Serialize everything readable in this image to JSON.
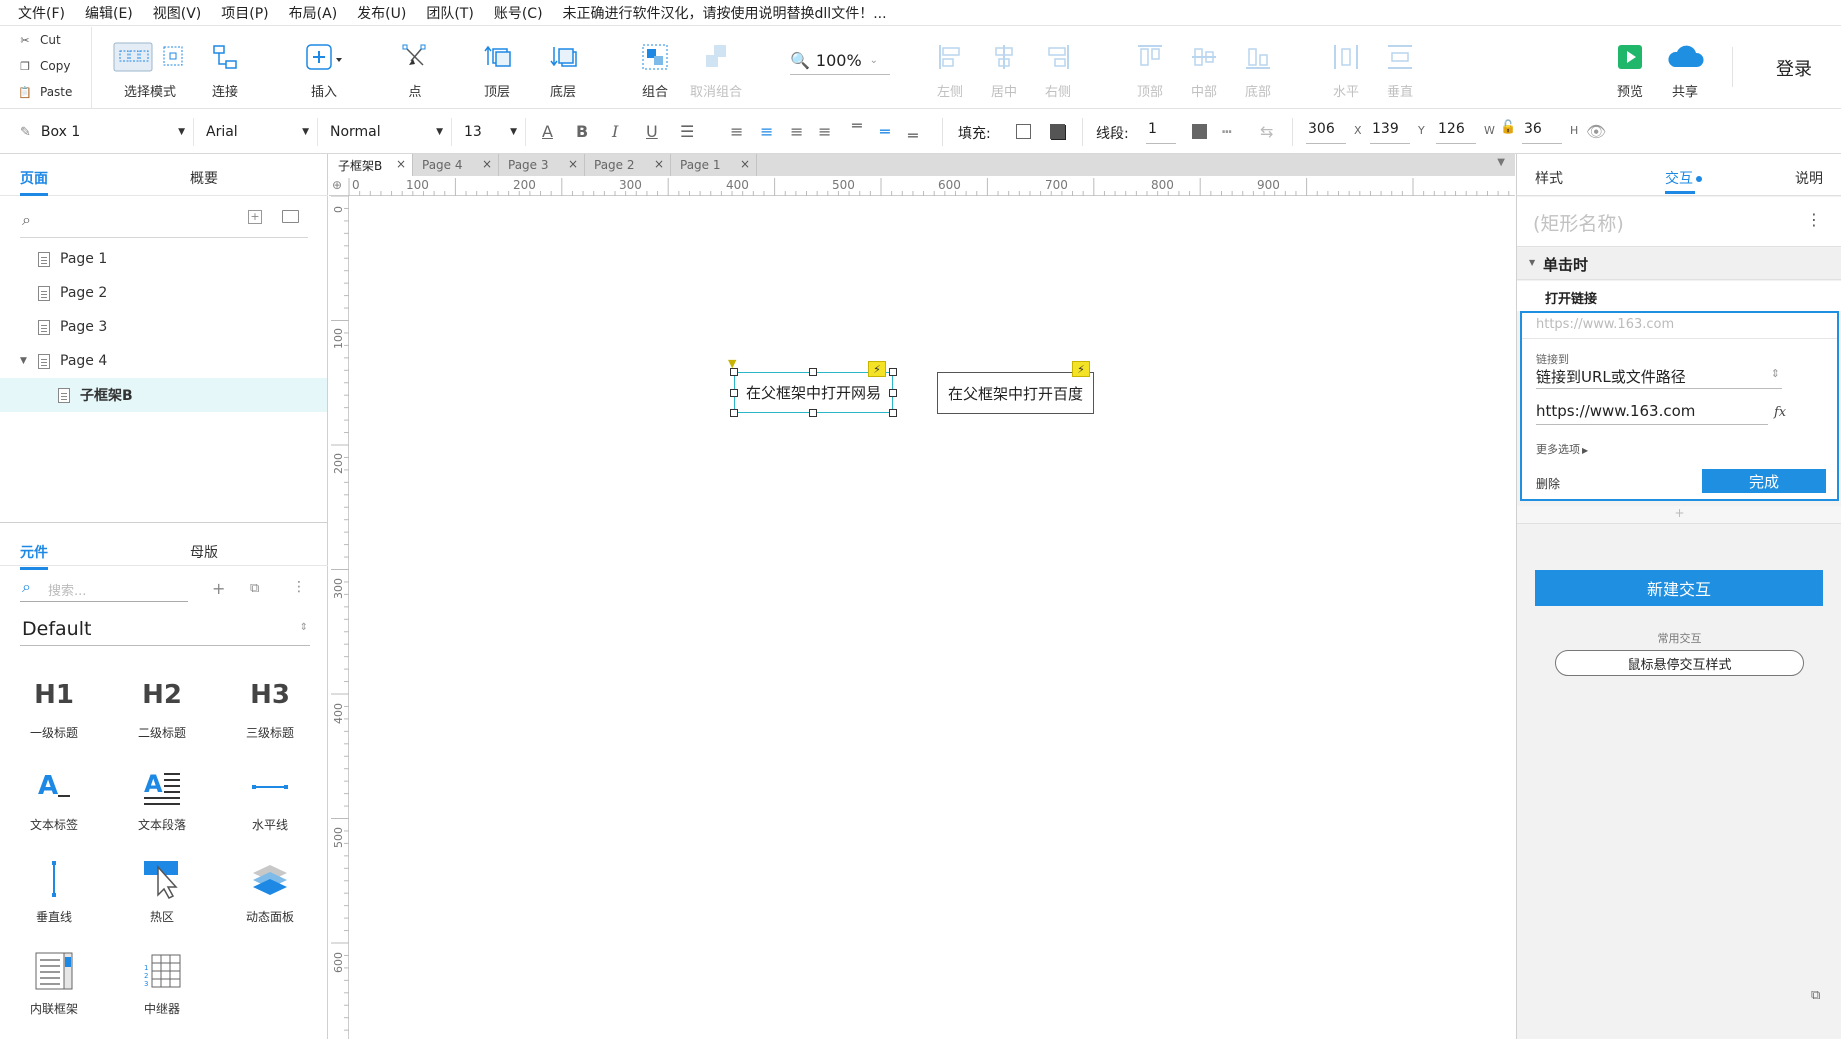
{
  "menu": [
    "文件(F)",
    "编辑(E)",
    "视图(V)",
    "项目(P)",
    "布局(A)",
    "发布(U)",
    "团队(T)",
    "账号(C)",
    "未正确进行软件汉化，请按使用说明替换dll文件！..."
  ],
  "clipboard": {
    "cut": "Cut",
    "copy": "Copy",
    "paste": "Paste"
  },
  "toolbar": {
    "select_mode": "选择模式",
    "connect": "连接",
    "insert": "插入",
    "point": "点",
    "top": "顶层",
    "bottom": "底层",
    "group": "组合",
    "ungroup": "取消组合",
    "zoom": "100%",
    "align_left": "左侧",
    "align_center": "居中",
    "align_right": "右侧",
    "align_top": "顶部",
    "align_middle": "中部",
    "align_bottom": "底部",
    "dist_h": "水平",
    "dist_v": "垂直",
    "preview": "预览",
    "share": "共享",
    "login": "登录"
  },
  "format": {
    "style": "Box 1",
    "font": "Arial",
    "weight": "Normal",
    "size": "13",
    "fill_label": "填充:",
    "line_label": "线段:",
    "line_width": "1",
    "x": "306",
    "y": "139",
    "w": "126",
    "h": "36",
    "x_label": "X",
    "y_label": "Y",
    "w_label": "W",
    "h_label": "H"
  },
  "left": {
    "tabs": [
      "页面",
      "概要"
    ],
    "pages": [
      {
        "label": "Page 1"
      },
      {
        "label": "Page 2"
      },
      {
        "label": "Page 3"
      },
      {
        "label": "Page 4"
      },
      {
        "label": "子框架B"
      }
    ],
    "lib_tabs": [
      "元件",
      "母版"
    ],
    "search_placeholder": "搜索...",
    "library": "Default",
    "widgets": [
      {
        "label": "一级标题",
        "glyph": "H1"
      },
      {
        "label": "二级标题",
        "glyph": "H2"
      },
      {
        "label": "三级标题",
        "glyph": "H3"
      },
      {
        "label": "文本标签",
        "glyph": "A_"
      },
      {
        "label": "文本段落",
        "glyph": "A≡"
      },
      {
        "label": "水平线",
        "glyph": "—"
      },
      {
        "label": "垂直线",
        "glyph": "|"
      },
      {
        "label": "热区",
        "glyph": "hot"
      },
      {
        "label": "动态面板",
        "glyph": "layers"
      },
      {
        "label": "内联框架",
        "glyph": "frame"
      },
      {
        "label": "中继器",
        "glyph": "grid"
      }
    ]
  },
  "doc_tabs": [
    "子框架B",
    "Page 4",
    "Page 3",
    "Page 2",
    "Page 1"
  ],
  "ruler_h": [
    "0",
    "100",
    "200",
    "300",
    "400",
    "500",
    "600",
    "700",
    "800",
    "900"
  ],
  "ruler_v": [
    "0",
    "100",
    "200",
    "300",
    "400",
    "500",
    "600"
  ],
  "canvas": {
    "shape1": "在父框架中打开网易",
    "shape2": "在父框架中打开百度"
  },
  "right": {
    "tabs": [
      "样式",
      "交互",
      "说明"
    ],
    "shape_name_placeholder": "(矩形名称)",
    "event": "单击时",
    "action": "打开链接",
    "link_preview": "https://www.163.com",
    "link_to_label": "链接到",
    "link_to_value": "链接到URL或文件路径",
    "url": "https://www.163.com",
    "more_options": "更多选项",
    "delete": "删除",
    "done": "完成",
    "new_interaction": "新建交互",
    "common_label": "常用交互",
    "hover_style": "鼠标悬停交互样式"
  },
  "colors": {
    "accent": "#1e88e5",
    "button": "#1e8fe1",
    "selection": "#2ab7c9",
    "bolt": "#f4e227"
  }
}
